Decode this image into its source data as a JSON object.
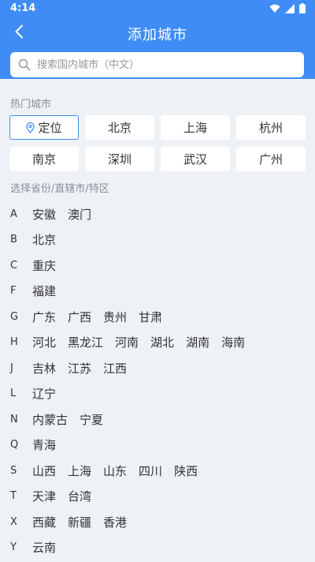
{
  "status": {
    "time": "4:14"
  },
  "header": {
    "title": "添加城市"
  },
  "search": {
    "placeholder": "搜索国内城市（中文）"
  },
  "hot": {
    "label": "热门城市",
    "locate_label": "定位",
    "cities": [
      "北京",
      "上海",
      "杭州",
      "南京",
      "深圳",
      "武汉",
      "广州"
    ]
  },
  "provinces": {
    "label": "选择省份/直辖市/特区",
    "groups": [
      {
        "letter": "A",
        "items": [
          "安徽",
          "澳门"
        ]
      },
      {
        "letter": "B",
        "items": [
          "北京"
        ]
      },
      {
        "letter": "C",
        "items": [
          "重庆"
        ]
      },
      {
        "letter": "F",
        "items": [
          "福建"
        ]
      },
      {
        "letter": "G",
        "items": [
          "广东",
          "广西",
          "贵州",
          "甘肃"
        ]
      },
      {
        "letter": "H",
        "items": [
          "河北",
          "黑龙江",
          "河南",
          "湖北",
          "湖南",
          "海南"
        ]
      },
      {
        "letter": "J",
        "items": [
          "吉林",
          "江苏",
          "江西"
        ]
      },
      {
        "letter": "L",
        "items": [
          "辽宁"
        ]
      },
      {
        "letter": "N",
        "items": [
          "内蒙古",
          "宁夏"
        ]
      },
      {
        "letter": "Q",
        "items": [
          "青海"
        ]
      },
      {
        "letter": "S",
        "items": [
          "山西",
          "上海",
          "山东",
          "四川",
          "陕西"
        ]
      },
      {
        "letter": "T",
        "items": [
          "天津",
          "台湾"
        ]
      },
      {
        "letter": "X",
        "items": [
          "西藏",
          "新疆",
          "香港"
        ]
      },
      {
        "letter": "Y",
        "items": [
          "云南"
        ]
      }
    ]
  },
  "colors": {
    "accent": "#3f8cf6",
    "background": "#eef2f7"
  }
}
